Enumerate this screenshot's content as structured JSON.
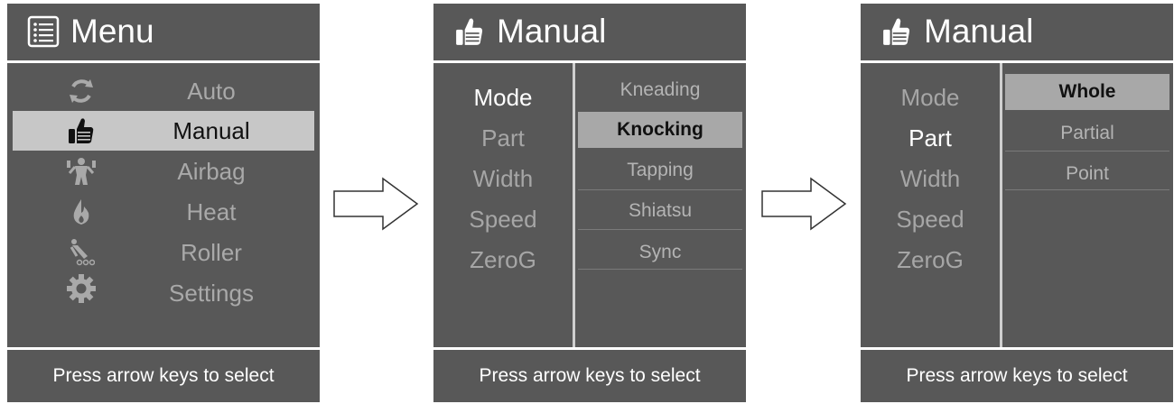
{
  "menu_panel": {
    "title": "Menu",
    "title_icon": "list-icon",
    "items": [
      {
        "label": "Auto",
        "icon": "refresh-icon",
        "selected": false
      },
      {
        "label": "Manual",
        "icon": "thumbs-up-icon",
        "selected": true
      },
      {
        "label": "Airbag",
        "icon": "airbag-body-icon",
        "selected": false
      },
      {
        "label": "Heat",
        "icon": "flame-icon",
        "selected": false
      },
      {
        "label": "Roller",
        "icon": "roller-icon",
        "selected": false
      },
      {
        "label": "Settings",
        "icon": "gear-icon",
        "selected": false
      }
    ],
    "footer": "Press arrow keys to select"
  },
  "manual_panel_1": {
    "title": "Manual",
    "title_icon": "thumbs-up-icon",
    "left_items": [
      "Mode",
      "Part",
      "Width",
      "Speed",
      "ZeroG"
    ],
    "active_left": "Mode",
    "right_items": [
      "Kneading",
      "Knocking",
      "Tapping",
      "Shiatsu",
      "Sync"
    ],
    "selected_right": "Knocking",
    "footer": "Press arrow keys to select"
  },
  "manual_panel_2": {
    "title": "Manual",
    "title_icon": "thumbs-up-icon",
    "left_items": [
      "Mode",
      "Part",
      "Width",
      "Speed",
      "ZeroG"
    ],
    "active_left": "Part",
    "right_items": [
      "Whole",
      "Partial",
      "Point"
    ],
    "selected_right": "Whole",
    "footer": "Press arrow keys to select"
  },
  "colors": {
    "panel_bg": "#585858",
    "selection_bg": "#c7c7c7",
    "text_active": "#ffffff",
    "text_inactive": "#a9a9a9"
  }
}
